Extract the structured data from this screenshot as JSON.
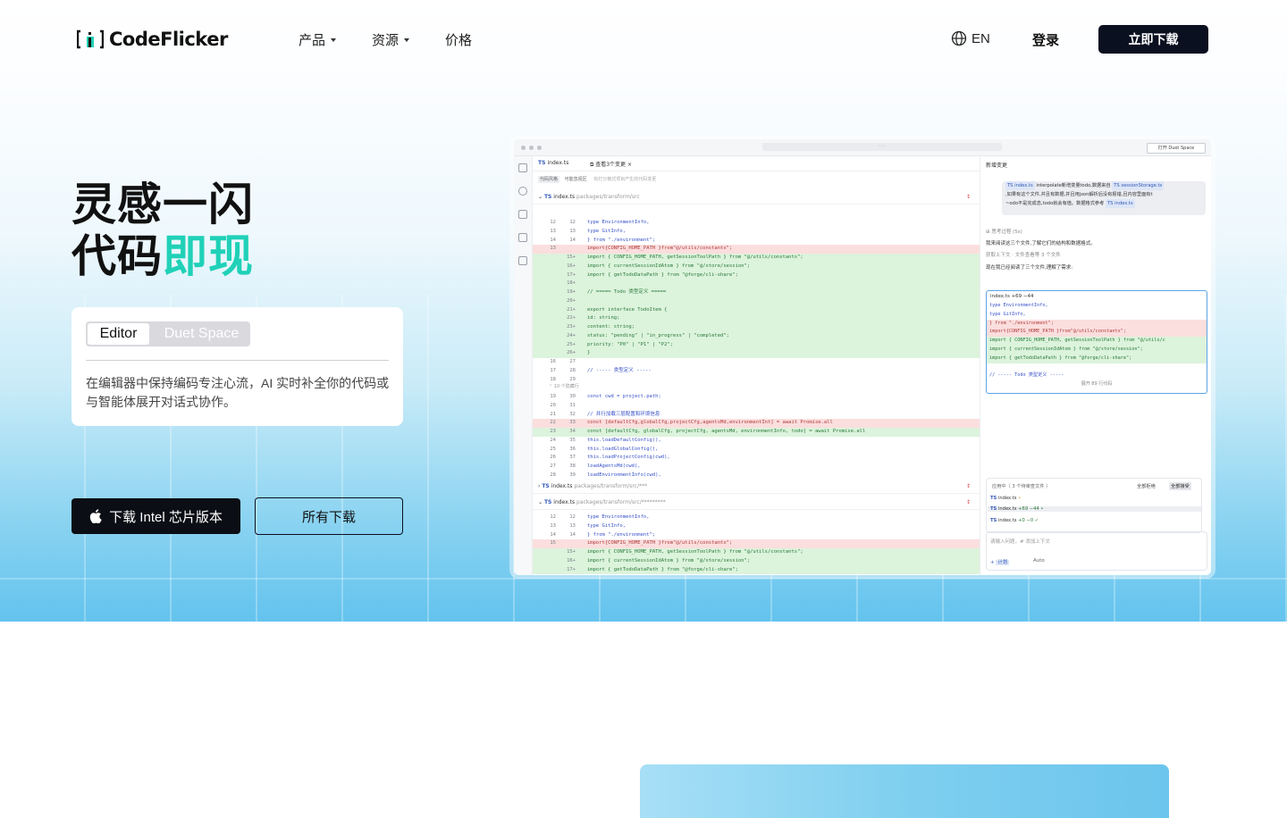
{
  "nav": {
    "logo_text": "CodeFlicker",
    "items": [
      {
        "label": "产品",
        "has_caret": true
      },
      {
        "label": "资源",
        "has_caret": true
      },
      {
        "label": "价格",
        "has_caret": false
      }
    ],
    "lang": "EN",
    "login": "登录",
    "download": "立即下载"
  },
  "hero": {
    "title_line1": "灵感一闪",
    "title_line2_plain": "代码",
    "title_line2_accent": "即现",
    "accent_color": "#20d1b7",
    "mode_tabs": [
      {
        "label": "Editor",
        "selected": true
      },
      {
        "label": "Duet Space",
        "selected": false
      }
    ],
    "mode_desc": "在编辑器中保持编码专注心流，AI 实时补全你的代码或与智能体展开对话式协作。",
    "btn_primary": "下载 Intel 芯片版本",
    "btn_secondary": "所有下载"
  },
  "ide": {
    "open_btn": "打开 Duet Space",
    "tabs": [
      "index.ts",
      "查看3个变更"
    ],
    "subtabs": [
      "代码风格",
      "可能忽视区",
      "有打分格式项目产生的代码变更"
    ],
    "file1": {
      "name": "index.ts",
      "path": "packages/transform/src"
    },
    "file2": {
      "name": "index.ts",
      "path": "packages/transform/src/***"
    },
    "file3": {
      "name": "index.ts",
      "path": "packages/transform/src/*********"
    },
    "code1": [
      {
        "a": "12",
        "b": "12",
        "t": "  type EnvironmentInfo,",
        "k": ""
      },
      {
        "a": "13",
        "b": "13",
        "t": "  type GitInfo,",
        "k": ""
      },
      {
        "a": "14",
        "b": "14",
        "t": "} from \"./environment\";",
        "k": ""
      },
      {
        "a": "13",
        "b": "",
        "t": "import{CONFIG_HOME_PATH }from\"@/utils/constants\";",
        "k": "del"
      },
      {
        "a": "",
        "b": "15+",
        "t": "import { CONFIG_HOME_PATH, getSessionToolPath } from \"@/utils/constants\";",
        "k": "add"
      },
      {
        "a": "",
        "b": "16+",
        "t": "import { currentSessionIdAtom } from \"@/store/session\";",
        "k": "add"
      },
      {
        "a": "",
        "b": "17+",
        "t": "import { getTodoDataPath } from \"@forge/cli-share\";",
        "k": "add"
      },
      {
        "a": "",
        "b": "18+",
        "t": "",
        "k": "add"
      },
      {
        "a": "",
        "b": "19+",
        "t": "// ===== Todo 类型定义 =====",
        "k": "add"
      },
      {
        "a": "",
        "b": "20+",
        "t": "",
        "k": "add"
      },
      {
        "a": "",
        "b": "21+",
        "t": "export interface TodoItem {",
        "k": "add"
      },
      {
        "a": "",
        "b": "22+",
        "t": "  id: string;",
        "k": "add"
      },
      {
        "a": "",
        "b": "23+",
        "t": "  content: string;",
        "k": "add"
      },
      {
        "a": "",
        "b": "24+",
        "t": "  status: \"pending\" | \"in_progress\" | \"completed\";",
        "k": "add"
      },
      {
        "a": "",
        "b": "25+",
        "t": "  priority: \"P0\" | \"P1\" | \"P2\";",
        "k": "add"
      },
      {
        "a": "",
        "b": "26+",
        "t": "}",
        "k": "add"
      },
      {
        "a": "16",
        "b": "27",
        "t": "",
        "k": ""
      },
      {
        "a": "17",
        "b": "28",
        "t": "// ----- 类型定义 -----",
        "k": ""
      },
      {
        "a": "18",
        "b": "29",
        "t": "",
        "k": ""
      }
    ],
    "collapsed": "10 个隐藏行",
    "code2": [
      {
        "a": "19",
        "b": "30",
        "t": "const cwd = project.path;",
        "k": ""
      },
      {
        "a": "20",
        "b": "31",
        "t": "",
        "k": ""
      },
      {
        "a": "21",
        "b": "32",
        "t": "  // 并行加载三层配置和环境信息",
        "k": ""
      },
      {
        "a": "22",
        "b": "33",
        "t": "const [defaultCfg,globalCfg,projectCfg,agentsMd,environmentInt] = await Promise.all",
        "k": "del"
      },
      {
        "a": "23",
        "b": "34",
        "t": "const [defaultCfg, globalCfg, projectCfg, agentsMd, environmentInfo, todo] = await Promise.all",
        "k": "add"
      },
      {
        "a": "24",
        "b": "35",
        "t": "    this.loadDefaultConfig(),",
        "k": ""
      },
      {
        "a": "25",
        "b": "36",
        "t": "    this.loadGlobalConfig(),",
        "k": ""
      },
      {
        "a": "26",
        "b": "37",
        "t": "    this.loadProjectConfig(cwd),",
        "k": ""
      },
      {
        "a": "27",
        "b": "38",
        "t": "    loadAgentsMd(cwd),",
        "k": ""
      },
      {
        "a": "28",
        "b": "39",
        "t": "    loadEnvironmentInfo(cwd),",
        "k": ""
      }
    ],
    "code3": [
      {
        "a": "12",
        "b": "12",
        "t": "  type EnvironmentInfo,",
        "k": ""
      },
      {
        "a": "13",
        "b": "13",
        "t": "  type GitInfo,",
        "k": ""
      },
      {
        "a": "14",
        "b": "14",
        "t": "} from \"./environment\";",
        "k": ""
      },
      {
        "a": "15",
        "b": "",
        "t": "import{CONFIG_HOME_PATH }from\"@/utils/constants\";",
        "k": "del"
      },
      {
        "a": "",
        "b": "15+",
        "t": "import { CONFIG_HOME_PATH, getSessionToolPath } from \"@/utils/constants\";",
        "k": "add"
      },
      {
        "a": "",
        "b": "16+",
        "t": "import { currentSessionIdAtom } from \"@/store/session\";",
        "k": "add"
      },
      {
        "a": "",
        "b": "17+",
        "t": "import { getTodoDataPath } from \"@forge/cli-share\";",
        "k": "add"
      }
    ],
    "chat": {
      "title": "新增变更",
      "bubble_prefix": "index.ts",
      "bubble_text1": "interpolate新增变量todo,数据来自",
      "bubble_tag": "sessionStorage.ts",
      "bubble_text2": ",如果有这个文件,并且有数据,并且用json解析后没有报错,且内容里面有t",
      "bubble_text3": "~odo不是完成态,todo就会有值。数据格式参考",
      "bubble_tag2": "index.ts",
      "thinking": "思考过程 (5s)",
      "line1": "我来阅读这三个文件,了解它们的结构和数据格式。",
      "line2": "获取上下文 · 文件查看等 3 个文件",
      "line3": "现在我已经阅读了三个文件,理解了需求:",
      "diff_head": "index.ts +69 −44",
      "diff_lines": [
        {
          "t": "  type EnvironmentInfo,",
          "k": ""
        },
        {
          "t": "  type GitInfo,",
          "k": ""
        },
        {
          "t": "} from \"./environment\";",
          "k": "del"
        },
        {
          "t": "import{CONFIG_HOME_PATH }from\"@/utils/constants\";",
          "k": "del"
        },
        {
          "t": "import { CONFIG_HOME_PATH, getSessionToolPath } from \"@/utils/c",
          "k": "add"
        },
        {
          "t": "import { currentSessionIdAtom } from \"@/store/session\";",
          "k": "add"
        },
        {
          "t": "import { getTodoDataPath } from \"@forge/cli-share\";",
          "k": "add"
        },
        {
          "t": "",
          "k": ""
        },
        {
          "t": "// ----- Todo 类型定义 -----",
          "k": ""
        }
      ],
      "diff_foot": "展开 89 行代码",
      "applying": "应用中（ 3 个待审查文件 ）",
      "reject_all": "全部拒绝",
      "accept_all": "全部接受",
      "files": [
        {
          "name": "index.ts",
          "delta": "•"
        },
        {
          "name": "index.ts",
          "delta": "+69 −44 •"
        },
        {
          "name": "index.ts",
          "delta": "+0 −0 ✓"
        }
      ],
      "input_placeholder": "请输入问题，# 添加上下文",
      "plan": "计划",
      "auto": "Auto"
    }
  }
}
